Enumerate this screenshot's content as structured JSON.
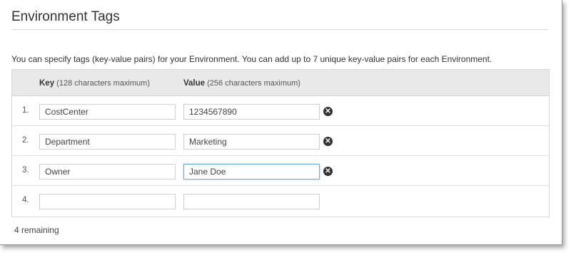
{
  "section": {
    "title": "Environment Tags",
    "description": "You can specify tags (key-value pairs) for your Environment. You can add up to 7 unique key-value pairs for each Environment."
  },
  "table": {
    "key_header": "Key",
    "key_hint": "(128 characters maximum)",
    "value_header": "Value",
    "value_hint": "(256 characters maximum)",
    "rows": [
      {
        "num": "1.",
        "key": "CostCenter",
        "value": "1234567890",
        "removable": true
      },
      {
        "num": "2.",
        "key": "Department",
        "value": "Marketing",
        "removable": true
      },
      {
        "num": "3.",
        "key": "Owner",
        "value": "Jane Doe",
        "removable": true,
        "focused": true
      },
      {
        "num": "4.",
        "key": "",
        "value": "",
        "removable": false
      }
    ]
  },
  "remove_icon": "close-circle-icon",
  "remaining_text": "4 remaining"
}
